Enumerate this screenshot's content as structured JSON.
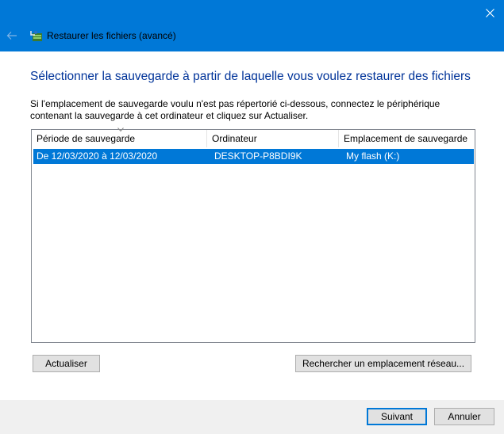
{
  "window": {
    "title": "Restaurer les fichiers (avancé)"
  },
  "main": {
    "heading": "Sélectionner la sauvegarde à partir de laquelle vous voulez restaurer des fichiers",
    "instructions": "Si l'emplacement de sauvegarde voulu n'est pas répertorié ci-dessous, connectez le périphérique contenant la sauvegarde à cet ordinateur et cliquez sur Actualiser."
  },
  "table": {
    "columns": [
      "Période de sauvegarde",
      "Ordinateur",
      "Emplacement de sauvegarde"
    ],
    "rows": [
      [
        "De 12/03/2020 à 12/03/2020",
        "DESKTOP-P8BDI9K",
        "My flash (K:)"
      ]
    ],
    "selected_row": 0,
    "sort_column": 0
  },
  "buttons": {
    "refresh": "Actualiser",
    "browse_network": "Rechercher un emplacement réseau...",
    "next": "Suivant",
    "cancel": "Annuler"
  },
  "colors": {
    "accent": "#0078d7",
    "heading": "#003399",
    "footer": "#f0f0f0"
  },
  "icons": {
    "close": "close-icon",
    "back": "back-arrow-icon",
    "app": "backup-restore-icon"
  }
}
